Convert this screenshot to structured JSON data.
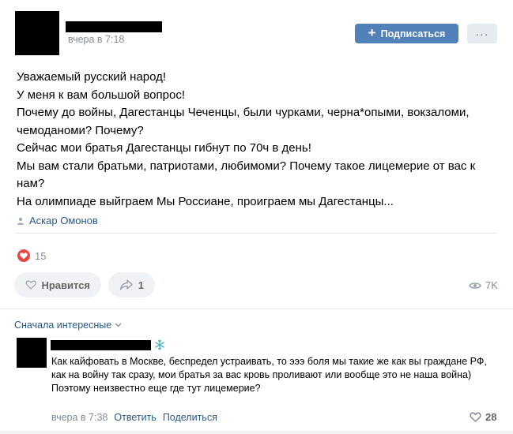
{
  "post": {
    "time": "вчера в 7:18",
    "subscribe_label": "Подписаться",
    "more_label": "···",
    "text_lines": [
      "Уважаемый русский народ!",
      "У меня к вам большой вопрос!",
      "Почему до войны, Дагестанцы Чеченцы, были чурками, черна*опыми, вокзаломи, чемоданоми? Почему?",
      "Сейчас мои братья Дагестанцы гибнут по 70ч в день!",
      "Мы вам стали братьми, патриотами, любимоми? Почему такое лицемерие от вас к нам?",
      "На олимпиаде выйграем Мы Россиане, проиграем мы Дагестанцы..."
    ],
    "signature": "Аскар Омонов",
    "likes_count": "15",
    "like_label": "Нравится",
    "share_count": "1",
    "views": "7K"
  },
  "comments": {
    "sort_label": "Сначала интересные",
    "items": [
      {
        "text_lines": [
          "Как кайфовать в Москве, беспредел устраивать, то эээ боля мы такие же как вы граждане РФ, как на войну так сразу, мои братья за вас кровь проливают или вообще это не наша война)",
          "Поэтому неизвестно еще где тут лицемерие?"
        ],
        "time": "вчера в 7:38",
        "reply_label": "Ответить",
        "share_label": "Поделиться",
        "likes": "28"
      }
    ]
  },
  "colors": {
    "accent": "#5181b8",
    "link": "#2a5885",
    "heart": "#e64646",
    "muted": "#818c99"
  }
}
